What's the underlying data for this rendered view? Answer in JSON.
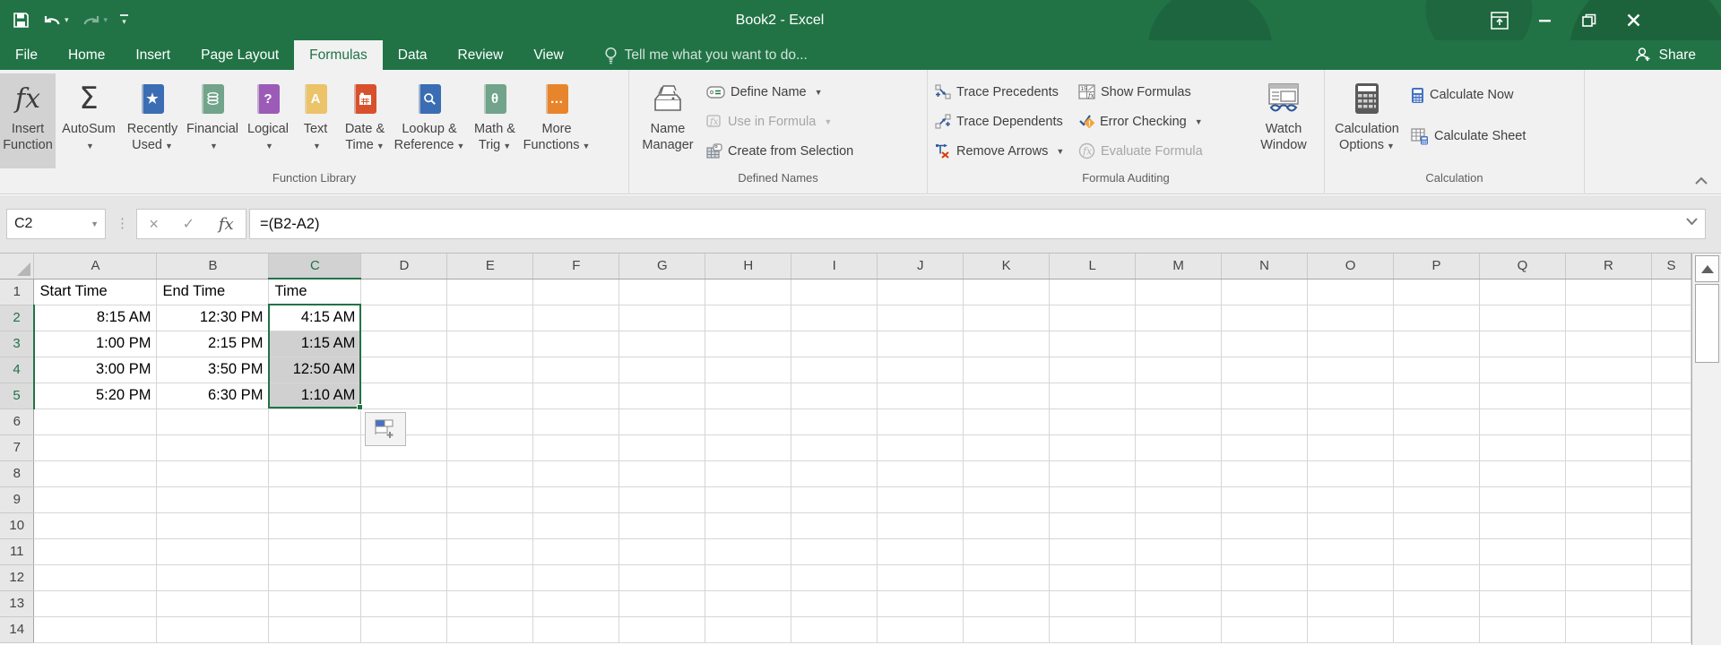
{
  "window": {
    "title": "Book2 - Excel"
  },
  "tabs": {
    "items": [
      "File",
      "Home",
      "Insert",
      "Page Layout",
      "Formulas",
      "Data",
      "Review",
      "View"
    ],
    "active": "Formulas"
  },
  "search": {
    "placeholder": "Tell me what you want to do..."
  },
  "share": {
    "label": "Share"
  },
  "ribbon": {
    "function_library": {
      "group_label": "Function Library",
      "insert_function": {
        "l1": "Insert",
        "l2": "Function"
      },
      "autosum": {
        "l1": "AutoSum",
        "l2": ""
      },
      "recently_used": {
        "l1": "Recently",
        "l2": "Used"
      },
      "financial": {
        "l1": "Financial",
        "l2": ""
      },
      "logical": {
        "l1": "Logical",
        "l2": ""
      },
      "text": {
        "l1": "Text",
        "l2": ""
      },
      "date_time": {
        "l1": "Date &",
        "l2": "Time"
      },
      "lookup": {
        "l1": "Lookup &",
        "l2": "Reference"
      },
      "math": {
        "l1": "Math &",
        "l2": "Trig"
      },
      "more": {
        "l1": "More",
        "l2": "Functions"
      }
    },
    "defined_names": {
      "group_label": "Defined Names",
      "name_manager": {
        "l1": "Name",
        "l2": "Manager"
      },
      "define_name": "Define Name",
      "use_in_formula": "Use in Formula",
      "create_from_selection": "Create from Selection"
    },
    "formula_auditing": {
      "group_label": "Formula Auditing",
      "trace_precedents": "Trace Precedents",
      "trace_dependents": "Trace Dependents",
      "remove_arrows": "Remove Arrows",
      "show_formulas": "Show Formulas",
      "error_checking": "Error Checking",
      "evaluate_formula": "Evaluate Formula",
      "watch_window": {
        "l1": "Watch",
        "l2": "Window"
      }
    },
    "calculation": {
      "group_label": "Calculation",
      "calculation_options": {
        "l1": "Calculation",
        "l2": "Options"
      },
      "calculate_now": "Calculate Now",
      "calculate_sheet": "Calculate Sheet"
    }
  },
  "formula_bar": {
    "name_box": "C2",
    "formula": "=(B2-A2)"
  },
  "sheet": {
    "col_headers": [
      "A",
      "B",
      "C",
      "D",
      "E",
      "F",
      "G",
      "H",
      "I",
      "J",
      "K",
      "L",
      "M",
      "N",
      "O",
      "P",
      "Q",
      "R",
      "S"
    ],
    "visible_rows": 14,
    "cells": {
      "A1": "Start Time",
      "B1": "End Time",
      "C1": "Time",
      "A2": "8:15 AM",
      "B2": "12:30 PM",
      "C2": "4:15 AM",
      "A3": "1:00 PM",
      "B3": "2:15 PM",
      "C3": "1:15 AM",
      "A4": "3:00 PM",
      "B4": "3:50 PM",
      "C4": "12:50 AM",
      "A5": "5:20 PM",
      "B5": "6:30 PM",
      "C5": "1:10 AM"
    },
    "selection": {
      "range": "C2:C5",
      "active_cell": "C2"
    }
  },
  "colors": {
    "excel_green": "#217346",
    "ribbon_bg": "#f1f1f1",
    "formula_bar_bg": "#e6e6e6",
    "header_bg": "#e7e7e7",
    "selection_fill": "#d0d0d0",
    "book_blue": "#3a6db3",
    "book_green": "#71a48a",
    "book_purple": "#9b5bb7",
    "book_tan": "#ebc368",
    "book_red": "#d8512c",
    "book_orange": "#e8852c"
  }
}
